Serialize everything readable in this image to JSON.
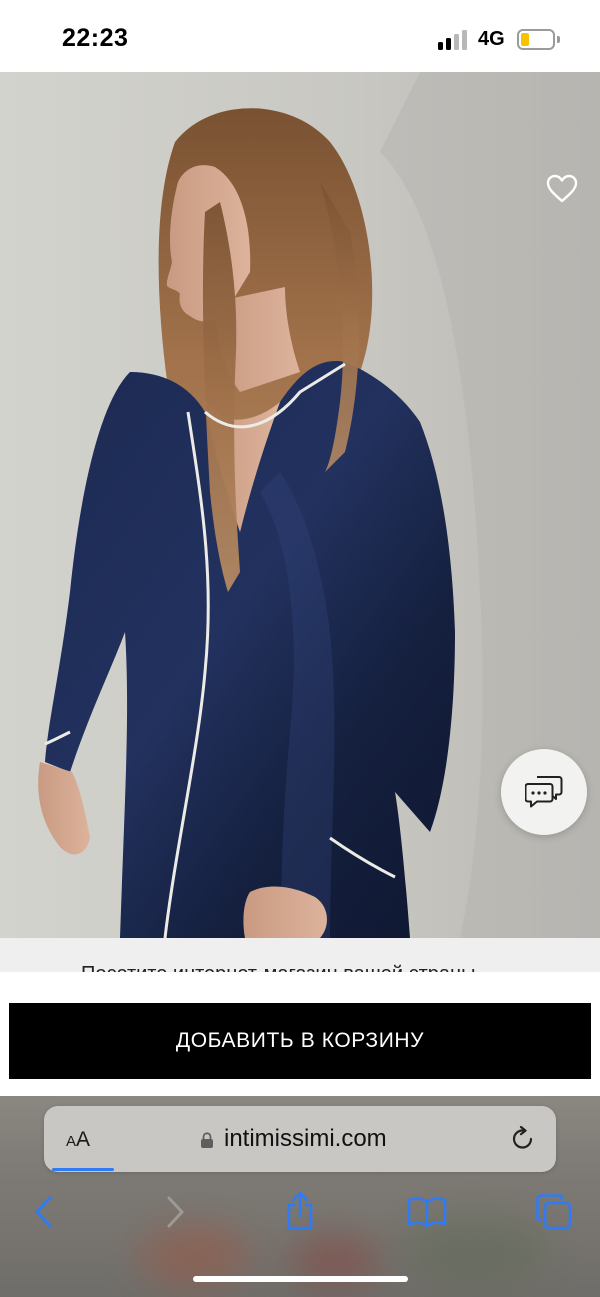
{
  "status_bar": {
    "time": "22:23",
    "network": "4G",
    "battery_level": 0.25,
    "battery_color": "#f5c400",
    "signal_icon": "cellular-signal-icon"
  },
  "product_photo": {
    "favorite_icon": "heart-outline-icon",
    "chat_icon": "chat-bubbles-icon"
  },
  "banner": {
    "text": "Посетите интернет-магазин вашей страны",
    "chevron_icon": "chevron-icon"
  },
  "cart": {
    "add_label": "ДОБАВИТЬ В КОРЗИНУ",
    "button_color": "#000000"
  },
  "browser": {
    "aa_small": "A",
    "aa_big": "A",
    "url": "intimissimi.com",
    "lock_icon": "lock-icon",
    "reload_icon": "reload-icon",
    "accent": "#2f7bf5",
    "toolbar": [
      "back-icon",
      "forward-icon",
      "share-icon",
      "bookmarks-icon",
      "tabs-icon"
    ]
  }
}
